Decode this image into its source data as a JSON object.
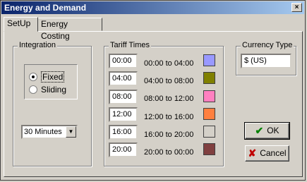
{
  "window": {
    "title": "Energy and Demand",
    "close_glyph": "×"
  },
  "tabs": [
    {
      "label": "SetUp",
      "active": true
    },
    {
      "label": "Energy Costing",
      "active": false
    }
  ],
  "integration": {
    "group_label": "Integration",
    "options": [
      {
        "label": "Fixed",
        "checked": true
      },
      {
        "label": "Sliding",
        "checked": false
      }
    ],
    "interval": {
      "selected": "30 Minutes"
    }
  },
  "tariff": {
    "group_label": "Tariff Times",
    "rows": [
      {
        "time": "00:00",
        "range": "00:00 to 04:00",
        "color": "#9999ff"
      },
      {
        "time": "04:00",
        "range": "04:00 to 08:00",
        "color": "#808000"
      },
      {
        "time": "08:00",
        "range": "08:00 to 12:00",
        "color": "#ff80c0"
      },
      {
        "time": "12:00",
        "range": "12:00 to 16:00",
        "color": "#ff8040"
      },
      {
        "time": "16:00",
        "range": "16:00 to 20:00",
        "color": "#d4d0c8"
      },
      {
        "time": "20:00",
        "range": "20:00 to 00:00",
        "color": "#804040"
      }
    ]
  },
  "currency": {
    "group_label": "Currency Type",
    "value": "$ (US)"
  },
  "buttons": {
    "ok_label": "OK",
    "ok_icon": "check-icon",
    "cancel_label": "Cancel",
    "cancel_icon": "cross-icon"
  },
  "colors": {
    "title_start": "#0a246a",
    "title_end": "#a6caf0",
    "ok_icon": "#008000",
    "cancel_icon": "#c00000"
  }
}
